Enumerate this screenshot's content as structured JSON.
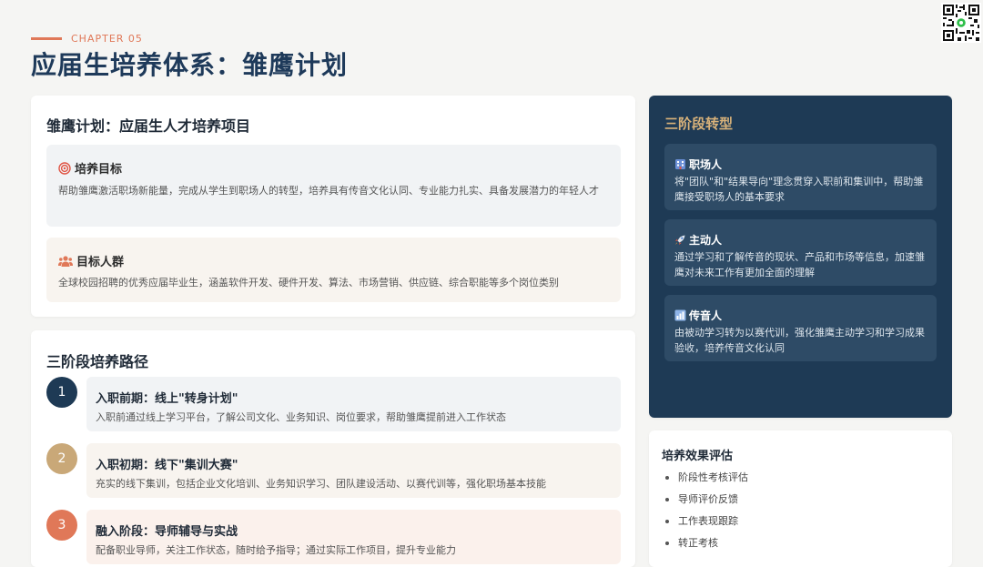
{
  "header": {
    "chapter": "CHAPTER 05",
    "title": "应届生培养体系：雏鹰计划"
  },
  "program": {
    "title": "雏鹰计划：应届生人才培养项目",
    "goal": {
      "icon": "target-icon",
      "title": "培养目标",
      "text": "帮助雏鹰激活职场新能量，完成从学生到职场人的转型，培养具有传音文化认同、专业能力扎实、具备发展潜力的年轻人才"
    },
    "audience": {
      "icon": "people-icon",
      "title": "目标人群",
      "text": "全球校园招聘的优秀应届毕业生，涵盖软件开发、硬件开发、算法、市场营销、供应链、综合职能等多个岗位类别"
    }
  },
  "path": {
    "title": "三阶段培养路径",
    "steps": [
      {
        "num": "1",
        "title": "入职前期：线上\"转身计划\"",
        "desc": "入职前通过线上学习平台，了解公司文化、业务知识、岗位要求，帮助雏鹰提前进入工作状态"
      },
      {
        "num": "2",
        "title": "入职初期：线下\"集训大赛\"",
        "desc": "充实的线下集训，包括企业文化培训、业务知识学习、团队建设活动、以赛代训等，强化职场基本技能"
      },
      {
        "num": "3",
        "title": "融入阶段：导师辅导与实战",
        "desc": "配备职业导师，关注工作状态，随时给予指导；通过实际工作项目，提升专业能力"
      }
    ]
  },
  "stages": {
    "title": "三阶段转型",
    "items": [
      {
        "icon": "building-icon",
        "title": "职场人",
        "desc": "将\"团队\"和\"结果导向\"理念贯穿入职前和集训中，帮助雏鹰接受职场人的基本要求"
      },
      {
        "icon": "rocket-icon",
        "title": "主动人",
        "desc": "通过学习和了解传音的现状、产品和市场等信息，加速雏鹰对未来工作有更加全面的理解"
      },
      {
        "icon": "chart-icon",
        "title": "传音人",
        "desc": "由被动学习转为以赛代训，强化雏鹰主动学习和学习成果验收，培养传音文化认同"
      }
    ]
  },
  "evaluation": {
    "title": "培养效果评估",
    "items": [
      "阶段性考核评估",
      "导师评价反馈",
      "工作表现跟踪",
      "转正考核"
    ]
  },
  "colors": {
    "accent": "#e07858",
    "navy": "#1e3a55",
    "gold": "#d8b27a",
    "step1": "#1e3a55",
    "step2": "#c9a878",
    "step3": "#e07858"
  }
}
